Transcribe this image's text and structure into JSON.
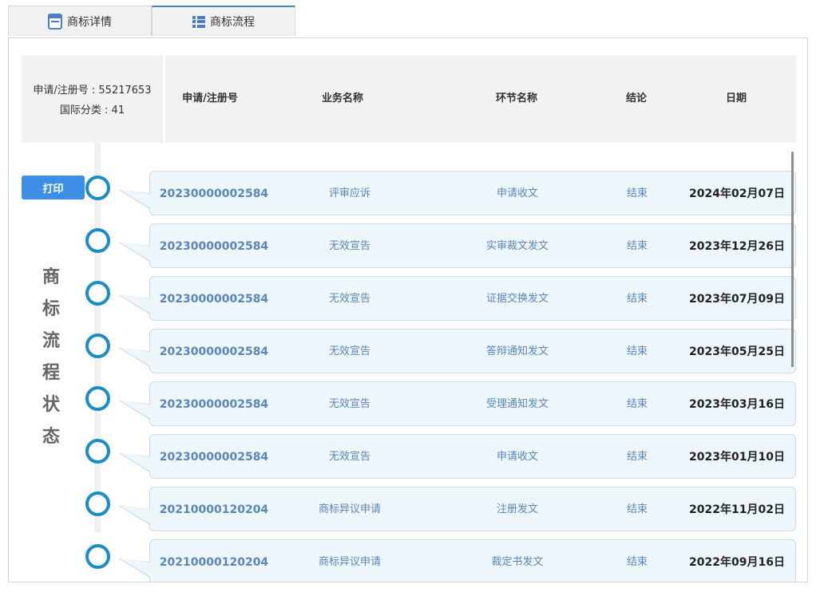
{
  "tabs": [
    {
      "label": "商标详情",
      "icon": "calendar-icon"
    },
    {
      "label": "商标流程",
      "icon": "list-icon"
    }
  ],
  "registration": {
    "number_line": "申请/注册号 : 55217653",
    "class_line": "国际分类 : 41"
  },
  "columns": {
    "no": "申请/注册号",
    "business": "业务名称",
    "step": "环节名称",
    "result": "结论",
    "date": "日期"
  },
  "print_label": "打印",
  "vertical_title": [
    "商",
    "标",
    "流",
    "程",
    "状",
    "态"
  ],
  "rows": [
    {
      "no": "20230000002584",
      "business": "评审应诉",
      "step": "申请收文",
      "result": "结束",
      "date": "2024年02月07日"
    },
    {
      "no": "20230000002584",
      "business": "无效宣告",
      "step": "实审裁文发文",
      "result": "结束",
      "date": "2023年12月26日"
    },
    {
      "no": "20230000002584",
      "business": "无效宣告",
      "step": "证据交换发文",
      "result": "结束",
      "date": "2023年07月09日"
    },
    {
      "no": "20230000002584",
      "business": "无效宣告",
      "step": "答辩通知发文",
      "result": "结束",
      "date": "2023年05月25日"
    },
    {
      "no": "20230000002584",
      "business": "无效宣告",
      "step": "受理通知发文",
      "result": "结束",
      "date": "2023年03月16日"
    },
    {
      "no": "20230000002584",
      "business": "无效宣告",
      "step": "申请收文",
      "result": "结束",
      "date": "2023年01月10日"
    },
    {
      "no": "20210000120204",
      "business": "商标异议申请",
      "step": "注册发文",
      "result": "结束",
      "date": "2022年11月02日"
    },
    {
      "no": "20210000120204",
      "business": "商标异议申请",
      "step": "裁定书发文",
      "result": "结束",
      "date": "2022年09月16日"
    }
  ]
}
